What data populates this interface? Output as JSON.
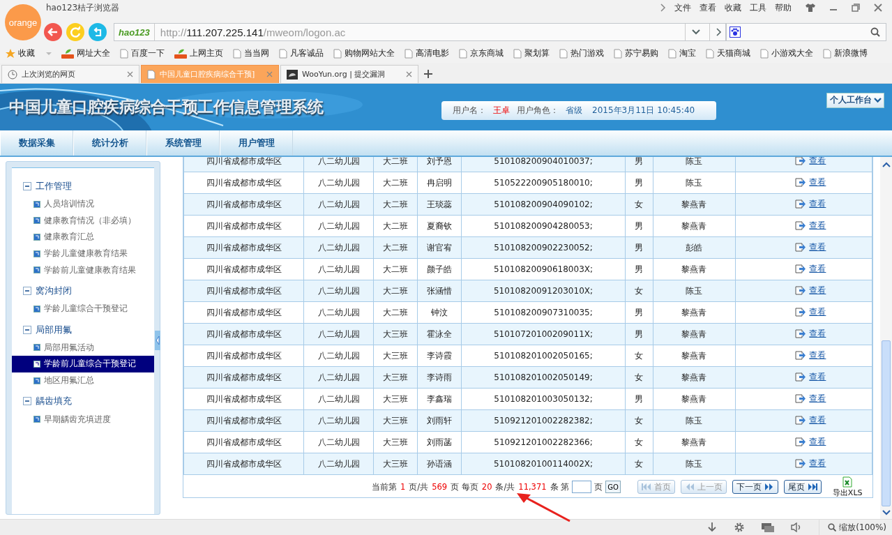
{
  "browser": {
    "logo": "orange",
    "title": "hao123桔子浏览器",
    "menu": [
      "文件",
      "查看",
      "收藏",
      "工具",
      "帮助"
    ],
    "address": {
      "badge": "hao123",
      "scheme": "http://",
      "host": "111.207.225.141",
      "path": "/mweom/logon.ac"
    },
    "bookmarks": [
      {
        "label": "收藏",
        "kind": "star"
      },
      {
        "label": "网址大全",
        "kind": "hao"
      },
      {
        "label": "百度一下",
        "kind": "page"
      },
      {
        "label": "上网主页",
        "kind": "hao"
      },
      {
        "label": "当当网",
        "kind": "page"
      },
      {
        "label": "凡客诚品",
        "kind": "page"
      },
      {
        "label": "购物网站大全",
        "kind": "page"
      },
      {
        "label": "高清电影",
        "kind": "page"
      },
      {
        "label": "京东商城",
        "kind": "page"
      },
      {
        "label": "聚划算",
        "kind": "page"
      },
      {
        "label": "热门游戏",
        "kind": "page"
      },
      {
        "label": "苏宁易购",
        "kind": "page"
      },
      {
        "label": "淘宝",
        "kind": "page"
      },
      {
        "label": "天猫商城",
        "kind": "page"
      },
      {
        "label": "小游戏大全",
        "kind": "page"
      },
      {
        "label": "新浪微博",
        "kind": "page"
      }
    ],
    "tabs": [
      {
        "label": "上次浏览的网页",
        "kind": "history",
        "selected": false
      },
      {
        "label": "中国儿童口腔疾病综合干预]",
        "kind": "page",
        "selected": true
      },
      {
        "label": "WooYun.org | 提交漏洞",
        "kind": "site",
        "selected": false
      }
    ],
    "status_zoom": "缩放(100%)"
  },
  "app": {
    "title": "中国儿童口腔疾病综合干预工作信息管理系统",
    "user_label": "用户名：",
    "user": "王卓",
    "role_label": "用户角色：",
    "role": "省级",
    "datetime": "2015年3月11日  10:45:40",
    "workspace": "个人工作台",
    "nav": [
      "数据采集",
      "统计分析",
      "系统管理",
      "用户管理"
    ],
    "sidebar": [
      {
        "title": "工作管理",
        "expanded": true,
        "children": [
          {
            "label": "人员培训情况",
            "selected": false
          },
          {
            "label": "健康教育情况（非必填）",
            "selected": false
          },
          {
            "label": "健康教育汇总",
            "selected": false
          },
          {
            "label": "学龄儿童健康教育结果",
            "selected": false
          },
          {
            "label": "学龄前儿童健康教育结果",
            "selected": false
          }
        ]
      },
      {
        "title": "窝沟封闭",
        "expanded": true,
        "children": [
          {
            "label": "学龄儿童综合干预登记",
            "selected": false
          }
        ]
      },
      {
        "title": "局部用氟",
        "expanded": true,
        "children": [
          {
            "label": "局部用氟活动",
            "selected": false
          },
          {
            "label": "学龄前儿童综合干预登记",
            "selected": true
          },
          {
            "label": "地区用氟汇总",
            "selected": false
          }
        ]
      },
      {
        "title": "龋齿填充",
        "expanded": true,
        "children": [
          {
            "label": "早期龋齿充填进度",
            "selected": false
          }
        ]
      }
    ],
    "rows": [
      [
        "四川省成都市成华区",
        "八二幼儿园",
        "大二班",
        "刘予恩",
        "510108200904010037;",
        "男",
        "陈玉",
        "查看"
      ],
      [
        "四川省成都市成华区",
        "八二幼儿园",
        "大二班",
        "冉启明",
        "510522200905180010;",
        "男",
        "陈玉",
        "查看"
      ],
      [
        "四川省成都市成华区",
        "八二幼儿园",
        "大二班",
        "王琰蕊",
        "510108200904090102;",
        "女",
        "黎燕青",
        "查看"
      ],
      [
        "四川省成都市成华区",
        "八二幼儿园",
        "大二班",
        "夏裔钦",
        "510108200904280053;",
        "男",
        "黎燕青",
        "查看"
      ],
      [
        "四川省成都市成华区",
        "八二幼儿园",
        "大二班",
        "谢官宥",
        "510108200902230052;",
        "男",
        "彭皓",
        "查看"
      ],
      [
        "四川省成都市成华区",
        "八二幼儿园",
        "大二班",
        "颜子皓",
        "51010820090618003X;",
        "男",
        "黎燕青",
        "查看"
      ],
      [
        "四川省成都市成华区",
        "八二幼儿园",
        "大二班",
        "张涵惜",
        "51010820091203010X;",
        "女",
        "陈玉",
        "查看"
      ],
      [
        "四川省成都市成华区",
        "八二幼儿园",
        "大二班",
        "钟汶",
        "510108200907310035;",
        "男",
        "黎燕青",
        "查看"
      ],
      [
        "四川省成都市成华区",
        "八二幼儿园",
        "大三班",
        "霍泳全",
        "51010720100209011X;",
        "男",
        "黎燕青",
        "查看"
      ],
      [
        "四川省成都市成华区",
        "八二幼儿园",
        "大三班",
        "李诗霞",
        "510108201002050165;",
        "女",
        "黎燕青",
        "查看"
      ],
      [
        "四川省成都市成华区",
        "八二幼儿园",
        "大三班",
        "李诗雨",
        "510108201002050149;",
        "女",
        "黎燕青",
        "查看"
      ],
      [
        "四川省成都市成华区",
        "八二幼儿园",
        "大三班",
        "李鑫瑞",
        "510108201003050132;",
        "男",
        "黎燕青",
        "查看"
      ],
      [
        "四川省成都市成华区",
        "八二幼儿园",
        "大三班",
        "刘雨轩",
        "510921201002282382;",
        "女",
        "陈玉",
        "查看"
      ],
      [
        "四川省成都市成华区",
        "八二幼儿园",
        "大三班",
        "刘雨菡",
        "510921201002282366;",
        "女",
        "黎燕青",
        "查看"
      ],
      [
        "四川省成都市成华区",
        "八二幼儿园",
        "大三班",
        "孙语涵",
        "51010820100114002X;",
        "女",
        "陈玉",
        "查看"
      ]
    ],
    "pager": {
      "segments": [
        {
          "kind": "text",
          "text": "当前第"
        },
        {
          "kind": "number",
          "text": "1"
        },
        {
          "kind": "text",
          "text": "页/共"
        },
        {
          "kind": "number",
          "text": "569"
        },
        {
          "kind": "text",
          "text": "页 每页"
        },
        {
          "kind": "number",
          "text": "20"
        },
        {
          "kind": "text",
          "text": "条/共"
        },
        {
          "kind": "number",
          "text": "11,371"
        },
        {
          "kind": "text",
          "text": "条 第"
        }
      ],
      "page_suffix": "页",
      "go": "GO",
      "buttons": [
        {
          "label": "首页",
          "kind": "first",
          "disabled": true
        },
        {
          "label": "上一页",
          "kind": "prev",
          "disabled": true
        },
        {
          "label": "下一页",
          "kind": "next",
          "disabled": false
        },
        {
          "label": "尾页",
          "kind": "last",
          "disabled": false
        }
      ],
      "export": "导出XLS"
    }
  }
}
